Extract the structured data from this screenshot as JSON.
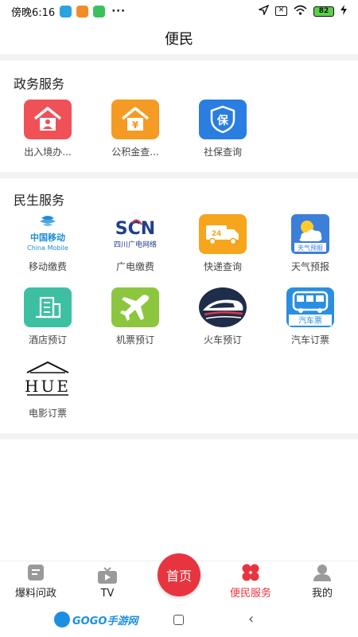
{
  "status_bar": {
    "time": "傍晚6:16",
    "dots": "···",
    "battery": "82"
  },
  "header": {
    "title": "便民"
  },
  "sections": [
    {
      "title": "政务服务",
      "items": [
        {
          "label": "出入境办...",
          "icon": "house-person-icon",
          "color": "#ef5157"
        },
        {
          "label": "公积金查...",
          "icon": "house-yen-icon",
          "color": "#f59a23"
        },
        {
          "label": "社保查询",
          "icon": "shield-bao-icon",
          "color": "#2a7de1",
          "glyph": "保"
        }
      ]
    },
    {
      "title": "民生服务",
      "items": [
        {
          "label": "移动缴费",
          "icon": "china-mobile-logo",
          "logo_text": "中国移动",
          "logo_sub": "China Mobile"
        },
        {
          "label": "广电缴费",
          "icon": "scn-logo",
          "logo_text": "SCN",
          "logo_sub": "四川广电网络"
        },
        {
          "label": "快递查询",
          "icon": "delivery-truck-icon",
          "color": "#f7a51c",
          "glyph": "24"
        },
        {
          "label": "天气预报",
          "icon": "weather-icon",
          "color": "#3c7fd8",
          "glyph": "天气预报"
        },
        {
          "label": "酒店预订",
          "icon": "hotel-building-icon",
          "color": "#3dbfa3"
        },
        {
          "label": "机票预订",
          "icon": "airplane-icon",
          "color": "#8cc63f"
        },
        {
          "label": "火车预订",
          "icon": "train-icon",
          "color": "#1f2c4a"
        },
        {
          "label": "汽车订票",
          "icon": "bus-icon",
          "color": "#2a8fe0",
          "glyph": "汽车票"
        },
        {
          "label": "电影订票",
          "icon": "cinema-house-icon",
          "logo_text": "HUE"
        }
      ]
    }
  ],
  "bottom_nav": {
    "items": [
      {
        "label": "爆料问政",
        "icon": "report-icon"
      },
      {
        "label": "TV",
        "icon": "tv-icon"
      },
      {
        "label": "便民服务",
        "icon": "clover-icon",
        "active": true
      },
      {
        "label": "我的",
        "icon": "profile-icon"
      }
    ],
    "home_label": "首页"
  },
  "watermark": {
    "text": "GOGO手游网"
  },
  "colors": {
    "accent": "#e8343f",
    "divider": "#f2f2f4"
  }
}
